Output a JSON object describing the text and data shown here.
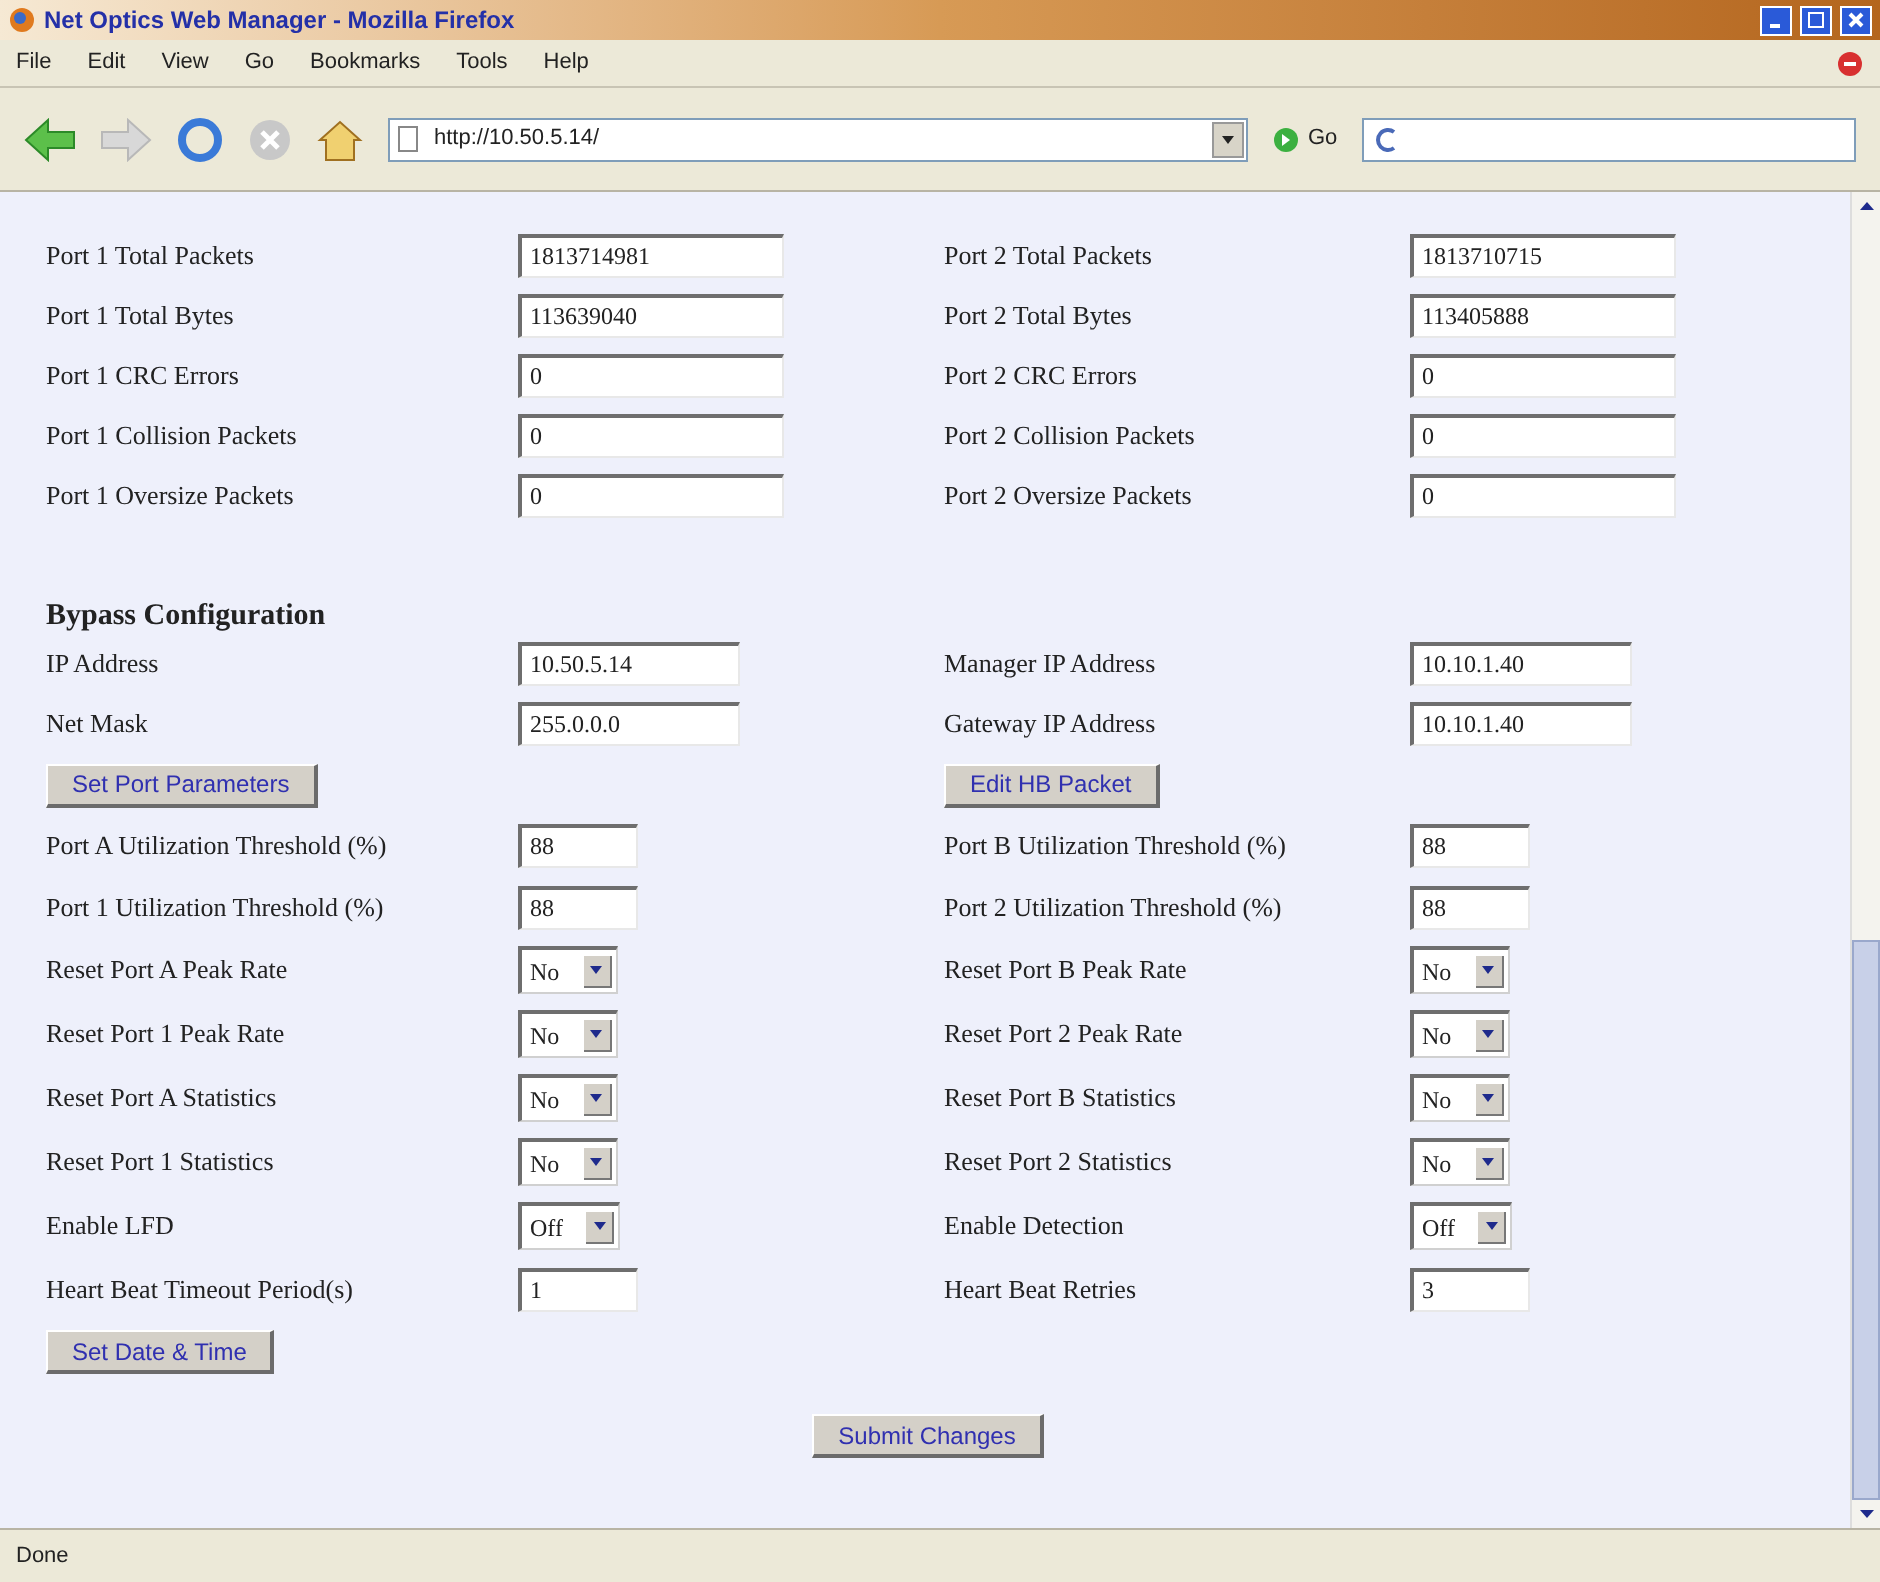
{
  "window": {
    "title": "Net Optics Web Manager - Mozilla Firefox"
  },
  "menu": [
    "File",
    "Edit",
    "View",
    "Go",
    "Bookmarks",
    "Tools",
    "Help"
  ],
  "toolbar": {
    "url": "http://10.50.5.14/",
    "go": "Go"
  },
  "statistics": [
    {
      "left": {
        "label": "Port 1 Total Packets",
        "value": "1813714981"
      },
      "right": {
        "label": "Port 2 Total Packets",
        "value": "1813710715"
      }
    },
    {
      "left": {
        "label": "Port 1 Total Bytes",
        "value": "113639040"
      },
      "right": {
        "label": "Port 2 Total Bytes",
        "value": "113405888"
      }
    },
    {
      "left": {
        "label": "Port 1 CRC Errors",
        "value": "0"
      },
      "right": {
        "label": "Port 2 CRC Errors",
        "value": "0"
      }
    },
    {
      "left": {
        "label": "Port 1 Collision Packets",
        "value": "0"
      },
      "right": {
        "label": "Port 2 Collision Packets",
        "value": "0"
      }
    },
    {
      "left": {
        "label": "Port 1 Oversize Packets",
        "value": "0"
      },
      "right": {
        "label": "Port 2 Oversize Packets",
        "value": "0"
      }
    }
  ],
  "bypass": {
    "heading": "Bypass Configuration",
    "addresses": [
      {
        "left": {
          "label": "IP Address",
          "value": "10.50.5.14"
        },
        "right": {
          "label": "Manager IP Address",
          "value": "10.10.1.40"
        }
      },
      {
        "left": {
          "label": "Net Mask",
          "value": "255.0.0.0"
        },
        "right": {
          "label": "Gateway IP Address",
          "value": "10.10.1.40"
        }
      }
    ],
    "buttons": [
      "Set Port Parameters",
      "Edit HB Packet"
    ],
    "settings": [
      {
        "left": {
          "kind": "field",
          "label": "Port A Utilization Threshold (%)",
          "value": "88"
        },
        "right": {
          "kind": "field",
          "label": "Port B Utilization Threshold (%)",
          "value": "88"
        }
      },
      {
        "left": {
          "kind": "field",
          "label": "Port 1 Utilization Threshold (%)",
          "value": "88"
        },
        "right": {
          "kind": "field",
          "label": "Port 2 Utilization Threshold (%)",
          "value": "88"
        }
      },
      {
        "left": {
          "kind": "select",
          "label": "Reset Port A Peak Rate",
          "value": "No"
        },
        "right": {
          "kind": "select",
          "label": "Reset Port B Peak Rate",
          "value": "No"
        }
      },
      {
        "left": {
          "kind": "select",
          "label": "Reset Port 1 Peak Rate",
          "value": "No"
        },
        "right": {
          "kind": "select",
          "label": "Reset Port 2 Peak Rate",
          "value": "No"
        }
      },
      {
        "left": {
          "kind": "select",
          "label": "Reset Port A Statistics",
          "value": "No"
        },
        "right": {
          "kind": "select",
          "label": "Reset Port B Statistics",
          "value": "No"
        }
      },
      {
        "left": {
          "kind": "select",
          "label": "Reset Port 1 Statistics",
          "value": "No"
        },
        "right": {
          "kind": "select",
          "label": "Reset Port 2 Statistics",
          "value": "No"
        }
      },
      {
        "left": {
          "kind": "select",
          "label": "Enable LFD",
          "value": "Off"
        },
        "right": {
          "kind": "select",
          "label": "Enable Detection",
          "value": "Off"
        }
      },
      {
        "left": {
          "kind": "field",
          "label": "Heart Beat Timeout Period(s)",
          "value": "1"
        },
        "right": {
          "kind": "field",
          "label": "Heart Beat Retries",
          "value": "3"
        }
      }
    ],
    "date_button": "Set Date & Time",
    "submit": "Submit Changes"
  },
  "status_bar": "Done"
}
